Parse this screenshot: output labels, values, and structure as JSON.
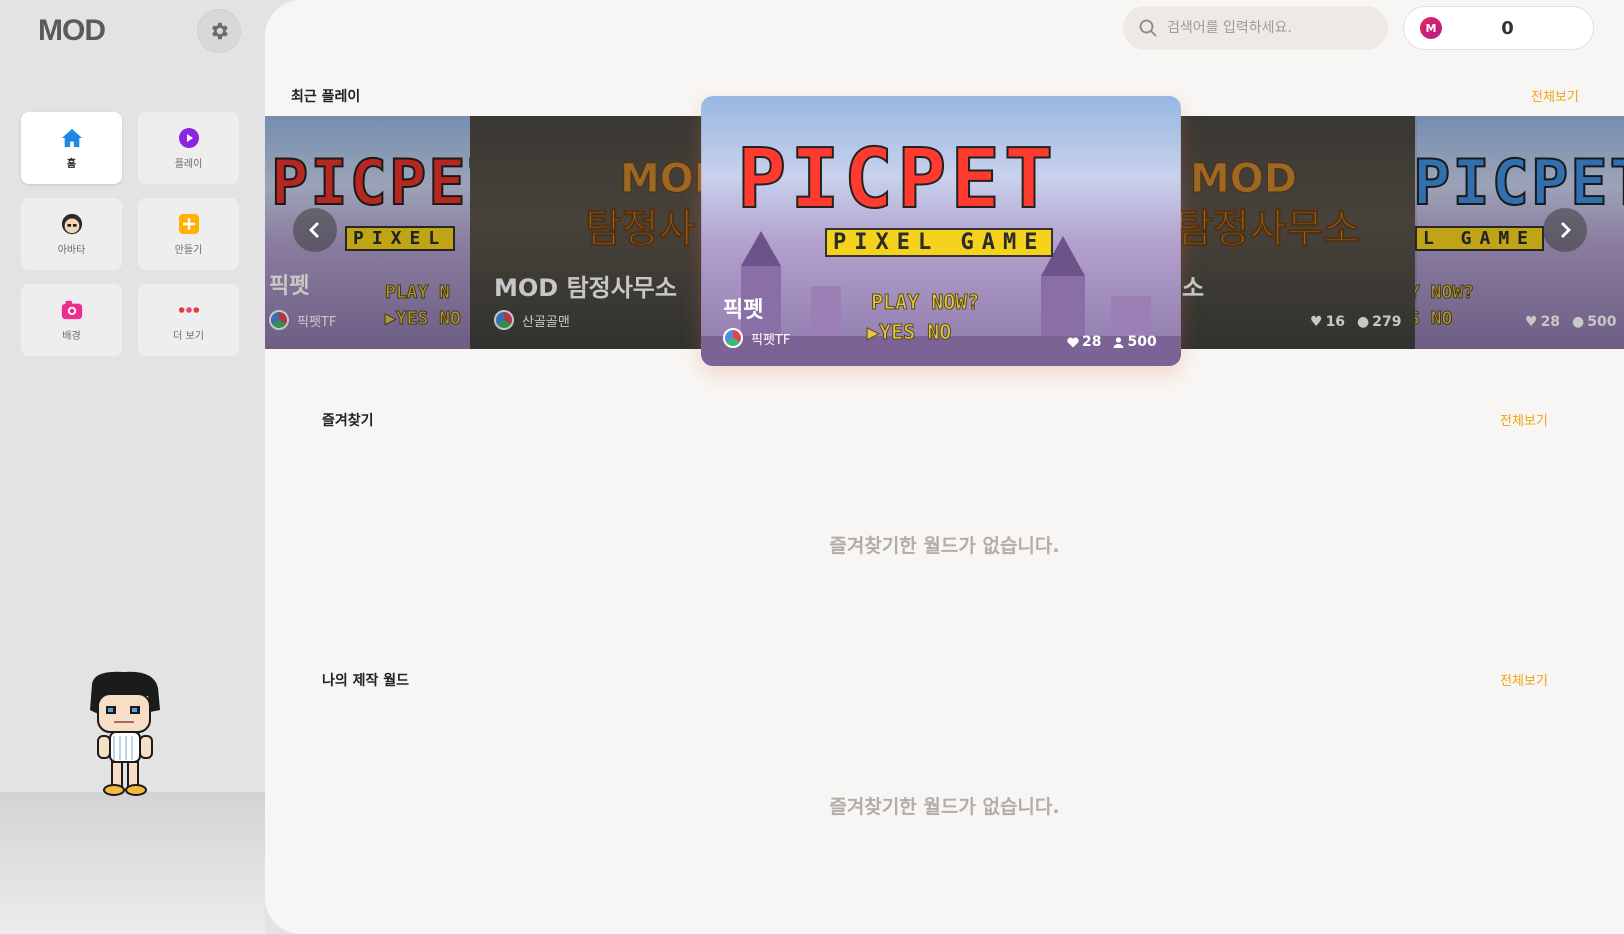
{
  "sidebar": {
    "logo": "MOD",
    "nav": [
      {
        "label": "홈",
        "icon": "home-icon"
      },
      {
        "label": "플레이",
        "icon": "play-icon"
      },
      {
        "label": "아바타",
        "icon": "avatar-icon"
      },
      {
        "label": "만들기",
        "icon": "create-icon"
      },
      {
        "label": "배경",
        "icon": "background-icon"
      },
      {
        "label": "더 보기",
        "icon": "more-icon"
      }
    ]
  },
  "header": {
    "search_placeholder": "검색어를 입력하세요.",
    "coin_symbol": "M",
    "coin_balance": "0"
  },
  "recent": {
    "title": "최근 플레이",
    "see_all": "전체보기",
    "featured": {
      "name": "픽펫",
      "author": "픽펫TF",
      "likes": "28",
      "players": "500",
      "logo_text": "PICPET",
      "logo_sub": "PIXEL GAME",
      "play_prompt": "PLAY NOW?",
      "yes": "YES",
      "no": "NO"
    },
    "cards": [
      {
        "name": "픽펫",
        "author": "픽펫TF",
        "logo_text": "PICPET",
        "logo_sub": "PIXEL",
        "play_prompt": "PLAY N",
        "yes": "YES",
        "no": "NO"
      },
      {
        "name": "MOD 탐정사무소",
        "author": "산골골맨",
        "logo_text": "MOD",
        "logo_sub": "탐정사"
      },
      {
        "name": "소",
        "logo_text": "MOD",
        "logo_sub": "탐정사무소",
        "likes": "16",
        "players": "279"
      },
      {
        "logo_text": "PICPET",
        "logo_sub": "L GAME",
        "play_prompt": "Y NOW?",
        "yes": "S",
        "no": "NO",
        "likes": "28",
        "players": "500"
      }
    ]
  },
  "favorites": {
    "title": "즐겨찾기",
    "see_all": "전체보기",
    "empty": "즐겨찾기한 월드가 없습니다."
  },
  "my_worlds": {
    "title": "나의 제작 월드",
    "see_all": "전체보기",
    "empty": "즐겨찾기한 월드가 없습니다."
  },
  "colors": {
    "accent": "#f0a313",
    "coin": "#e8245e"
  }
}
